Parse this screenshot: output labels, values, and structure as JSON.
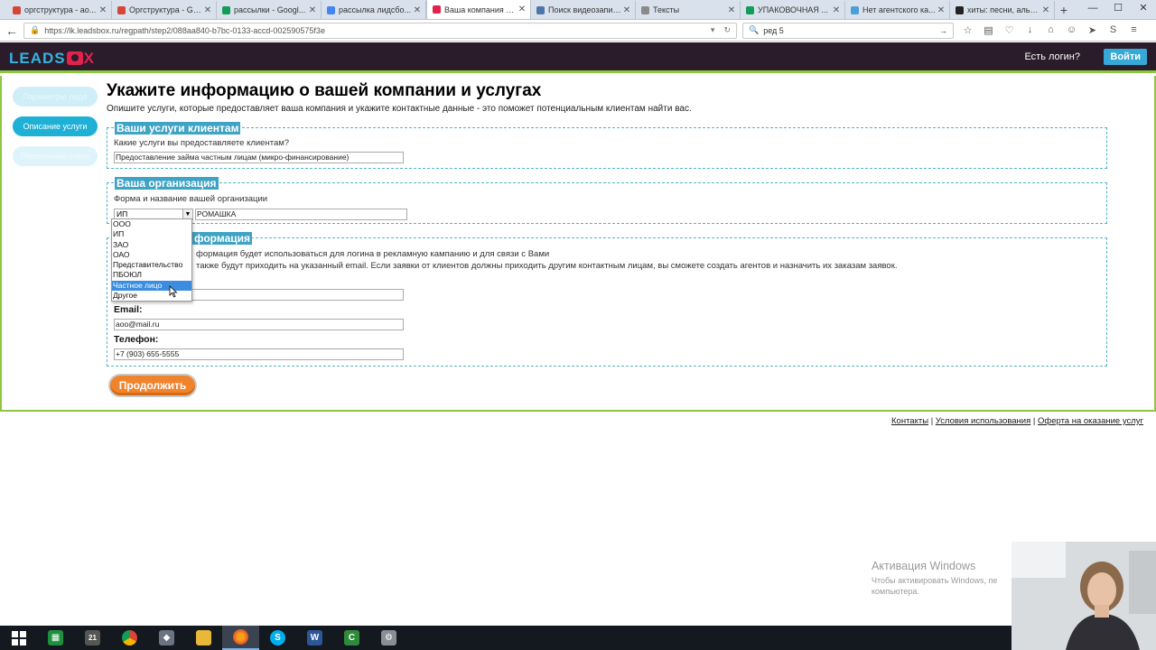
{
  "browser": {
    "tabs": [
      {
        "title": "оргструктура - ao...",
        "icon_color": "#d44638",
        "active": false
      },
      {
        "title": "Оргструктура - Go...",
        "icon_color": "#d44638",
        "active": false
      },
      {
        "title": "рассылки - Googl...",
        "icon_color": "#0f9d58",
        "active": false
      },
      {
        "title": "рассылка лидсбо...",
        "icon_color": "#4285f4",
        "active": false
      },
      {
        "title": "Ваша компания и ...",
        "icon_color": "#e0224d",
        "active": true
      },
      {
        "title": "Поиск видеозапис...",
        "icon_color": "#4a76a8",
        "active": false
      },
      {
        "title": "Тексты",
        "icon_color": "#8a8a8a",
        "active": false
      },
      {
        "title": "УПАКОВОЧНАЯ ...",
        "icon_color": "#0f9d58",
        "active": false
      },
      {
        "title": "Нет агентского ка...",
        "icon_color": "#4a9fd8",
        "active": false
      },
      {
        "title": "хиты: песни, альб...",
        "icon_color": "#222222",
        "active": false
      }
    ],
    "new_tab": "+",
    "url": "https://lk.leadsbox.ru/regpath/step2/088aa840-b7bc-0133-accd-002590575f3e",
    "search_value": "ред 5"
  },
  "header": {
    "logo_left": "LEADS",
    "logo_right": "X",
    "login_prompt": "Есть логин?",
    "login_button": "Войти",
    "accent": "#36b3e0",
    "border_color": "#8dc63f"
  },
  "steps": [
    {
      "label": "Параметры лида",
      "state": "done"
    },
    {
      "label": "Описание услуги",
      "state": "current"
    },
    {
      "label": "Пополнение счета",
      "state": "future"
    }
  ],
  "page": {
    "title": "Укажите информацию о вашей компании и услугах",
    "subtitle": "Опишите услуги, которые предоставляет ваша компания и укажите контактные данные - это поможет потенциальным клиентам найти вас."
  },
  "services": {
    "legend": "Ваши услуги клиентам",
    "label": "Какие услуги вы предоставляете клиентам?",
    "value": "Предоставление займа частным лицам (микро-финансирование)"
  },
  "organization": {
    "legend": "Ваша организация",
    "label": "Форма и название вашей организации",
    "form_value": "ИП",
    "name_value": "РОМАШКА",
    "options": [
      "ООО",
      "ИП",
      "ЗАО",
      "ОАО",
      "Представительство",
      "ПБОЮЛ",
      "Частное лицо",
      "Другое"
    ],
    "highlighted_option": "Частное лицо"
  },
  "contact": {
    "legend_visible": "формация",
    "line1_visible": "формация будет использоваться для логина в рекламную кампанию и для связи с Вами",
    "line2_visible": "также будут приходить на указанный email. Если заявки от клиентов должны приходить другим контактным лицам, вы сможете создать агентов и назначить их заказам заявок.",
    "email_label": "Email:",
    "email_value": "aoo@mail.ru",
    "phone_label": "Телефон:",
    "phone_value": "+7 (903) 655-5555"
  },
  "continue_button": "Продолжить",
  "footer": {
    "links": [
      "Контакты",
      "Условия использования",
      "Оферта на оказание услуг"
    ],
    "separator": "|"
  },
  "windows_activation": {
    "title": "Активация Windows",
    "text": "Чтобы активировать Windows, пе компьютера."
  },
  "taskbar": {
    "calendar_day": "21"
  }
}
